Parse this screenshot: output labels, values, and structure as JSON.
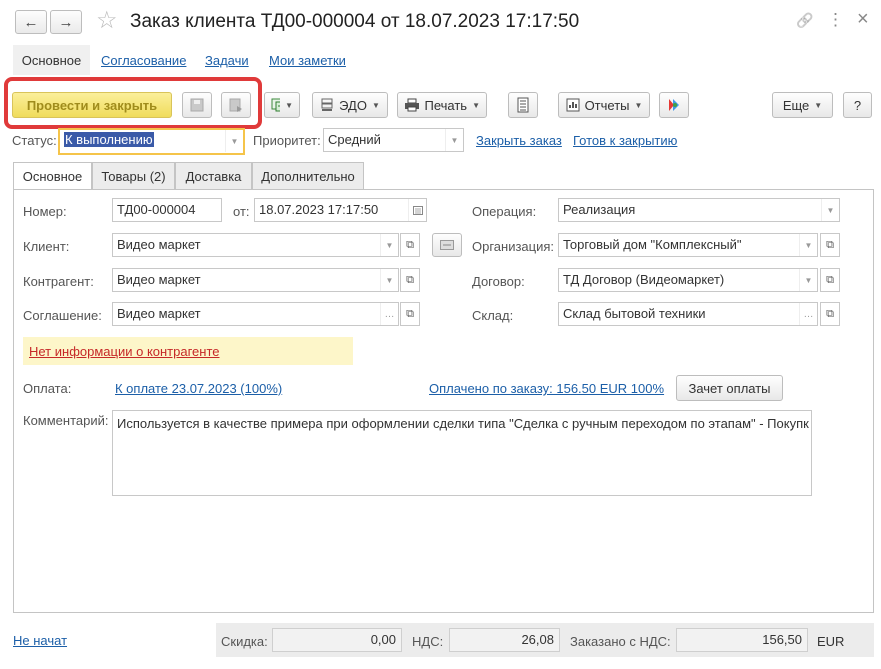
{
  "window": {
    "title": "Заказ клиента ТД00-000004 от 18.07.2023 17:17:50",
    "back_icon": "←",
    "forward_icon": "→",
    "star_icon": "☆",
    "link_icon": "🔗",
    "more_icon": "⋮",
    "close_icon": "×"
  },
  "top_tabs": [
    "Основное",
    "Согласование",
    "Задачи",
    "Мои заметки"
  ],
  "toolbar": {
    "post_close": "Провести и закрыть",
    "edo": "ЭДО",
    "print": "Печать",
    "reports": "Отчеты",
    "more": "Еще",
    "help": "?"
  },
  "status_row": {
    "status_label": "Статус:",
    "status_value": "К выполнению",
    "priority_label": "Приоритет:",
    "priority_value": "Средний",
    "close_order": "Закрыть заказ",
    "ready_to_close": "Готов к закрытию"
  },
  "inner_tabs": [
    "Основное",
    "Товары (2)",
    "Доставка",
    "Дополнительно"
  ],
  "form": {
    "number_label": "Номер:",
    "number_value": "ТД00-000004",
    "date_label": "от:",
    "date_value": "18.07.2023 17:17:50",
    "client_label": "Клиент:",
    "client_value": "Видео маркет",
    "counterparty_label": "Контрагент:",
    "counterparty_value": "Видео маркет",
    "agreement_label": "Соглашение:",
    "agreement_value": "Видео маркет",
    "operation_label": "Операция:",
    "operation_value": "Реализация",
    "organization_label": "Организация:",
    "organization_value": "Торговый дом \"Комплексный\"",
    "contract_label": "Договор:",
    "contract_value": "ТД Договор (Видеомаркет)",
    "warehouse_label": "Склад:",
    "warehouse_value": "Склад бытовой техники",
    "warning": "Нет информации о контрагенте",
    "payment_label": "Оплата:",
    "payment_link": "К оплате 23.07.2023 (100%)",
    "paid_link": "Оплачено по заказу: 156.50 EUR 100%",
    "offset_button": "Зачет оплаты",
    "comment_label": "Комментарий:",
    "comment_value": "Используется в качестве примера при оформлении сделки типа \"Сделка с ручным переходом по этапам\" - Покупк"
  },
  "footer": {
    "state_link": "Не начат",
    "discount_label": "Скидка:",
    "discount_value": "0,00",
    "vat_label": "НДС:",
    "vat_value": "26,08",
    "ordered_label": "Заказано с НДС:",
    "ordered_value": "156,50",
    "currency": "EUR"
  }
}
